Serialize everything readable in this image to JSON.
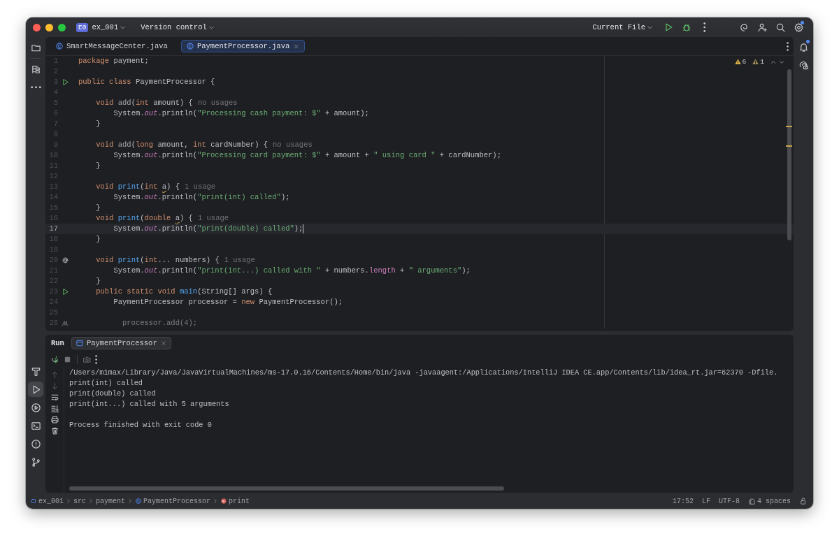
{
  "title_bar": {
    "project_badge": "E0",
    "project": "ex_001",
    "vcs": "Version control",
    "run_config": "Current File",
    "settings_badge": true
  },
  "left_toolbar": {
    "top": [
      {
        "kind": "project",
        "selected": false
      },
      {
        "kind": "structure",
        "selected": false
      },
      {
        "kind": "more",
        "selected": false
      }
    ],
    "bottom": [
      {
        "kind": "build",
        "selected": false
      },
      {
        "kind": "run",
        "selected": true
      },
      {
        "kind": "services",
        "selected": false
      },
      {
        "kind": "terminal",
        "selected": false
      },
      {
        "kind": "problems",
        "selected": false
      },
      {
        "kind": "git",
        "selected": false
      }
    ]
  },
  "right_toolbar": [
    {
      "kind": "notifications",
      "badge": true
    },
    {
      "kind": "ai-chat"
    }
  ],
  "editor_tabs": [
    {
      "label": "SmartMessageCenter.java",
      "selected": false
    },
    {
      "label": "PaymentProcessor.java",
      "selected": true
    }
  ],
  "inspections": {
    "warnings": "6",
    "weak_warnings": "1"
  },
  "code_lines": [
    {
      "number": "1",
      "current": false,
      "tokens": [
        {
          "kind": "kw",
          "text": "package"
        },
        {
          "kind": "plain",
          "text": " payment;"
        }
      ]
    },
    {
      "number": "2",
      "current": false
    },
    {
      "number": "3",
      "gutter": {
        "kind": "run"
      },
      "current": false,
      "tokens": [
        {
          "kind": "kw",
          "text": "public class"
        },
        {
          "kind": "plain",
          "text": " PaymentProcessor {"
        }
      ]
    },
    {
      "number": "4",
      "current": false
    },
    {
      "number": "5",
      "current": false,
      "hint": "no usages",
      "tokens": [
        {
          "kind": "kw",
          "text": "    void"
        },
        {
          "kind": "unused",
          "text": " add"
        },
        {
          "kind": "plain",
          "text": "("
        },
        {
          "kind": "kw",
          "text": "int"
        },
        {
          "kind": "plain",
          "text": " amount) {"
        }
      ]
    },
    {
      "number": "6",
      "current": false,
      "tokens": [
        {
          "kind": "plain",
          "text": "        System."
        },
        {
          "kind": "static",
          "text": "out"
        },
        {
          "kind": "plain",
          "text": ".println("
        },
        {
          "kind": "str",
          "text": "\"Processing cash payment: $\""
        },
        {
          "kind": "plain",
          "text": " + amount);"
        }
      ]
    },
    {
      "number": "7",
      "current": false,
      "tokens": [
        {
          "kind": "plain",
          "text": "    }"
        }
      ]
    },
    {
      "number": "8",
      "current": false
    },
    {
      "number": "9",
      "current": false,
      "hint": "no usages",
      "tokens": [
        {
          "kind": "kw",
          "text": "    void"
        },
        {
          "kind": "unused",
          "text": " add"
        },
        {
          "kind": "plain",
          "text": "("
        },
        {
          "kind": "kw",
          "text": "long"
        },
        {
          "kind": "plain",
          "text": " amount, "
        },
        {
          "kind": "kw",
          "text": "int"
        },
        {
          "kind": "plain",
          "text": " cardNumber) {"
        }
      ]
    },
    {
      "number": "10",
      "current": false,
      "tokens": [
        {
          "kind": "plain",
          "text": "        System."
        },
        {
          "kind": "static",
          "text": "out"
        },
        {
          "kind": "plain",
          "text": ".println("
        },
        {
          "kind": "str",
          "text": "\"Processing card payment: $\""
        },
        {
          "kind": "plain",
          "text": " + amount + "
        },
        {
          "kind": "str",
          "text": "\" using card \""
        },
        {
          "kind": "plain",
          "text": " + cardNumber);"
        }
      ]
    },
    {
      "number": "11",
      "current": false,
      "tokens": [
        {
          "kind": "plain",
          "text": "    }"
        }
      ]
    },
    {
      "number": "12",
      "current": false
    },
    {
      "number": "13",
      "current": false,
      "hint": "1 usage",
      "tokens": [
        {
          "kind": "kw",
          "text": "    void"
        },
        {
          "kind": "method",
          "text": " print"
        },
        {
          "kind": "plain",
          "text": "("
        },
        {
          "kind": "kw",
          "text": "int"
        },
        {
          "kind": "warn",
          "text": " a"
        },
        {
          "kind": "plain",
          "text": ") {"
        }
      ]
    },
    {
      "number": "14",
      "current": false,
      "tokens": [
        {
          "kind": "plain",
          "text": "        System."
        },
        {
          "kind": "static",
          "text": "out"
        },
        {
          "kind": "plain",
          "text": ".println("
        },
        {
          "kind": "str",
          "text": "\"print(int) called\""
        },
        {
          "kind": "plain",
          "text": ");"
        }
      ]
    },
    {
      "number": "15",
      "current": false,
      "tokens": [
        {
          "kind": "plain",
          "text": "    }"
        }
      ]
    },
    {
      "number": "16",
      "current": false,
      "hint": "1 usage",
      "tokens": [
        {
          "kind": "kw",
          "text": "    void"
        },
        {
          "kind": "method",
          "text": " print"
        },
        {
          "kind": "plain",
          "text": "("
        },
        {
          "kind": "kw",
          "text": "double"
        },
        {
          "kind": "warn",
          "text": " a"
        },
        {
          "kind": "plain",
          "text": ") {"
        }
      ]
    },
    {
      "number": "17",
      "current": true,
      "tokens": [
        {
          "kind": "plain",
          "text": "        System."
        },
        {
          "kind": "static",
          "text": "out"
        },
        {
          "kind": "plain",
          "text": ".println("
        },
        {
          "kind": "str",
          "text": "\"print(double) called\""
        },
        {
          "kind": "plain",
          "text": ");"
        }
      ]
    },
    {
      "number": "18",
      "current": false,
      "tokens": [
        {
          "kind": "plain",
          "text": "    }"
        }
      ]
    },
    {
      "number": "19",
      "current": false
    },
    {
      "number": "20",
      "gutter": {
        "kind": "override"
      },
      "current": false,
      "hint": "1 usage",
      "tokens": [
        {
          "kind": "kw",
          "text": "    void"
        },
        {
          "kind": "method",
          "text": " print"
        },
        {
          "kind": "plain",
          "text": "("
        },
        {
          "kind": "kw",
          "text": "int"
        },
        {
          "kind": "plain",
          "text": "... numbers) {"
        }
      ]
    },
    {
      "number": "21",
      "current": false,
      "tokens": [
        {
          "kind": "plain",
          "text": "        System."
        },
        {
          "kind": "static",
          "text": "out"
        },
        {
          "kind": "plain",
          "text": ".println("
        },
        {
          "kind": "str",
          "text": "\"print(int...) called with \""
        },
        {
          "kind": "plain",
          "text": " + numbers."
        },
        {
          "kind": "field",
          "text": "length"
        },
        {
          "kind": "plain",
          "text": " + "
        },
        {
          "kind": "str",
          "text": "\" arguments\""
        },
        {
          "kind": "plain",
          "text": ");"
        }
      ]
    },
    {
      "number": "22",
      "current": false,
      "tokens": [
        {
          "kind": "plain",
          "text": "    }"
        }
      ]
    },
    {
      "number": "23",
      "gutter": {
        "kind": "run"
      },
      "current": false,
      "tokens": [
        {
          "kind": "kw",
          "text": "    public static void"
        },
        {
          "kind": "method",
          "text": " main"
        },
        {
          "kind": "plain",
          "text": "(String[] args) {"
        }
      ]
    },
    {
      "number": "24",
      "current": false,
      "tokens": [
        {
          "kind": "plain",
          "text": "        PaymentProcessor processor = "
        },
        {
          "kind": "kw",
          "text": "new"
        },
        {
          "kind": "plain",
          "text": " PaymentProcessor();"
        }
      ]
    },
    {
      "number": "25",
      "current": false
    },
    {
      "number": "26",
      "gutter": {
        "kind": "ai"
      },
      "current": false,
      "tokens": [
        {
          "kind": "ghost",
          "text": "          processor.add(4);"
        }
      ]
    }
  ],
  "run_panel": {
    "title": "Run",
    "tabs": [
      {
        "label": "PaymentProcessor",
        "selected": true
      }
    ],
    "console": [
      "/Users/m1max/Library/Java/JavaVirtualMachines/ms-17.0.16/Contents/Home/bin/java -javaagent:/Applications/IntelliJ IDEA CE.app/Contents/lib/idea_rt.jar=62370 -Dfile.",
      "print(int) called",
      "print(double) called",
      "print(int...) called with 5 arguments",
      "Process finished with exit code 0"
    ]
  },
  "status_bar": {
    "breadcrumbs": [
      {
        "label": "ex_001",
        "kind": "module"
      },
      {
        "label": "src",
        "kind": "folder"
      },
      {
        "label": "payment",
        "kind": "folder"
      },
      {
        "label": "PaymentProcessor",
        "kind": "class"
      },
      {
        "label": "print",
        "kind": "method"
      }
    ],
    "position": "17:52",
    "line_ending": "LF",
    "encoding": "UTF-8",
    "indent": "4 spaces"
  }
}
